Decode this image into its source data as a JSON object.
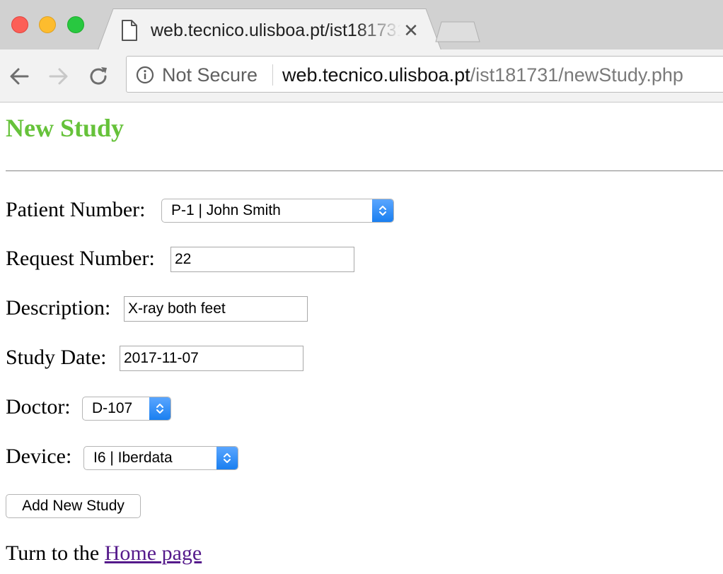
{
  "browser": {
    "tab_title": "web.tecnico.ulisboa.pt/ist181731/newStudy.php",
    "security_label": "Not Secure",
    "url_host": "web.tecnico.ulisboa.pt",
    "url_path": "/ist181731/newStudy.php",
    "icons": {
      "tab": "document-icon",
      "close": "close-icon",
      "back": "back-arrow-icon",
      "forward": "forward-arrow-icon",
      "reload": "reload-icon",
      "security": "info-icon"
    }
  },
  "page": {
    "title": "New Study",
    "title_color": "#66c23a",
    "link_color": "#551a8b"
  },
  "form": {
    "patient_label": "Patient Number:",
    "patient_value": "P-1 | John Smith",
    "request_label": "Request Number:",
    "request_value": "22",
    "description_label": "Description:",
    "description_value": "X-ray both feet",
    "date_label": "Study Date:",
    "date_value": "2017-11-07",
    "doctor_label": "Doctor:",
    "doctor_value": "D-107",
    "device_label": "Device:",
    "device_value": "I6 | Iberdata",
    "submit_label": "Add New Study"
  },
  "footer": {
    "prefix": "Turn to the",
    "link_text": "Home page"
  }
}
